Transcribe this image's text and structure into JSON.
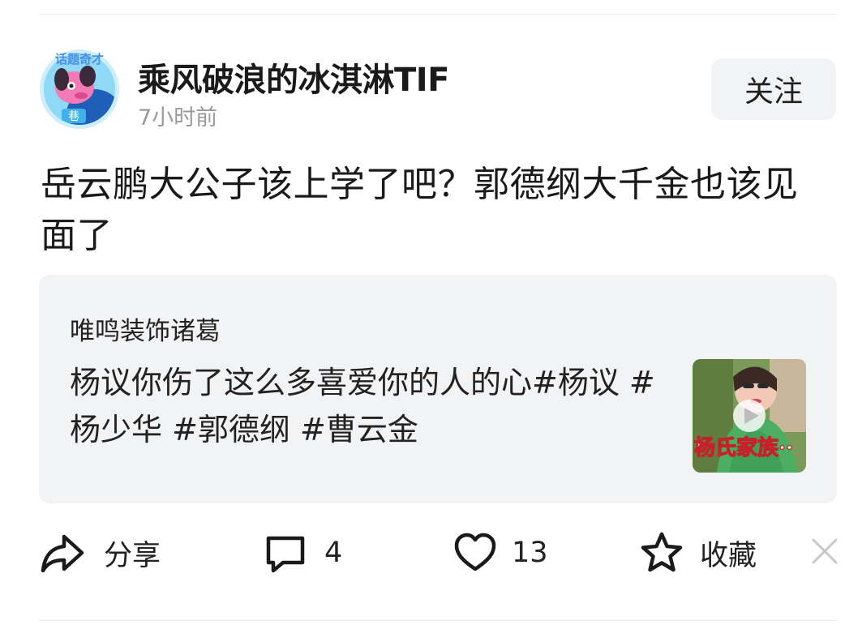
{
  "post": {
    "author": "乘风破浪的冰淇淋TIF",
    "time": "7小时前",
    "follow_label": "关注",
    "title": "岳云鹏大公子该上学了吧？郭德纲大千金也该见面了",
    "avatar_badge": "话题奇才"
  },
  "quote": {
    "author": "唯鸣装饰诸葛",
    "text": "杨议你伤了这么多喜爱你的人的心#杨议 #杨少华 #郭德纲 #曹云金",
    "thumb_caption": "杨氏家族··"
  },
  "actions": {
    "share_label": "分享",
    "comment_count": "4",
    "like_count": "13",
    "favorite_label": "收藏"
  },
  "icons": {
    "share": "share-icon",
    "comment": "comment-icon",
    "like": "heart-icon",
    "favorite": "star-icon",
    "dismiss": "close-icon",
    "play": "play-icon"
  },
  "colors": {
    "follow_bg": "#f2f3f5",
    "quote_bg": "#f2f3f5",
    "time_text": "#9a9a9a",
    "avatar_ring": "#6ec6ea"
  }
}
